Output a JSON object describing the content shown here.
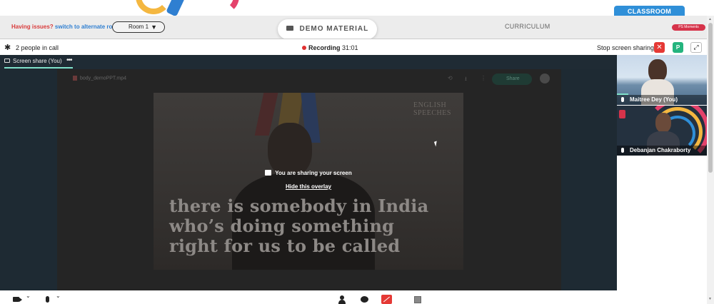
{
  "header": {
    "issues_prefix": "Having issues?",
    "issues_link": "switch to alternate room",
    "room_selected": "Room 1",
    "demo_material_label": "DEMO MATERIAL",
    "curriculum_label": "CURRICULUM",
    "classroom_tab_label": "CLASSROOM",
    "ps_moments_label": "PS Moments"
  },
  "callbar": {
    "people_count_text": "2 people in call",
    "recording_label": "Recording",
    "recording_time": "31:01",
    "stop_sharing_label": "Stop screen sharing",
    "participant_badge": "P"
  },
  "stage": {
    "share_tab_label": "Screen share (You)",
    "file_name": "body_demoPPT.mp4",
    "share_button_label": "Share",
    "overlay_message": "You are sharing your screen",
    "overlay_hide_link": "Hide this overlay",
    "video_brand_line1": "ENGLISH",
    "video_brand_line2": "SPEECHES",
    "subtitle_lines": [
      "there is somebody in India",
      "who’s doing something",
      "right for us to be called"
    ]
  },
  "participants": [
    {
      "name": "Maitree Dey (You)"
    },
    {
      "name": "Debanjan Chakraborty"
    }
  ],
  "colors": {
    "accent_red": "#e53935",
    "accent_green": "#24b47e",
    "classroom_blue": "#2f8fd8",
    "link_blue": "#2f7fd1",
    "warning_red": "#d93c3c"
  },
  "icons": {
    "settings": "gear-icon",
    "camera": "camera-icon",
    "microphone": "mic-icon",
    "participants": "people-icon",
    "chat": "chat-icon",
    "screenshare": "screenshare-icon",
    "whiteboard": "whiteboard-icon"
  }
}
